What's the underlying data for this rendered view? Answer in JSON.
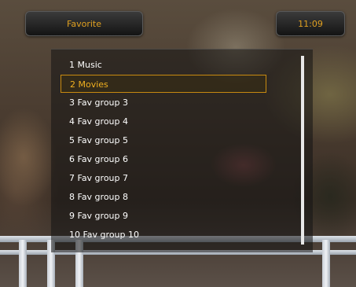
{
  "header": {
    "title": "Favorite",
    "clock": "11:09"
  },
  "list": {
    "items": [
      {
        "label": "1 Music"
      },
      {
        "label": "2 Movies"
      },
      {
        "label": "3 Fav group 3"
      },
      {
        "label": "4 Fav group 4"
      },
      {
        "label": "5 Fav group 5"
      },
      {
        "label": "6 Fav group 6"
      },
      {
        "label": "7 Fav group 7"
      },
      {
        "label": "8 Fav group 8"
      },
      {
        "label": "9 Fav group 9"
      },
      {
        "label": "10 Fav group 10"
      }
    ],
    "selected_index": 1
  },
  "colors": {
    "accent": "#e0a020",
    "selected_border": "#c88a10"
  }
}
